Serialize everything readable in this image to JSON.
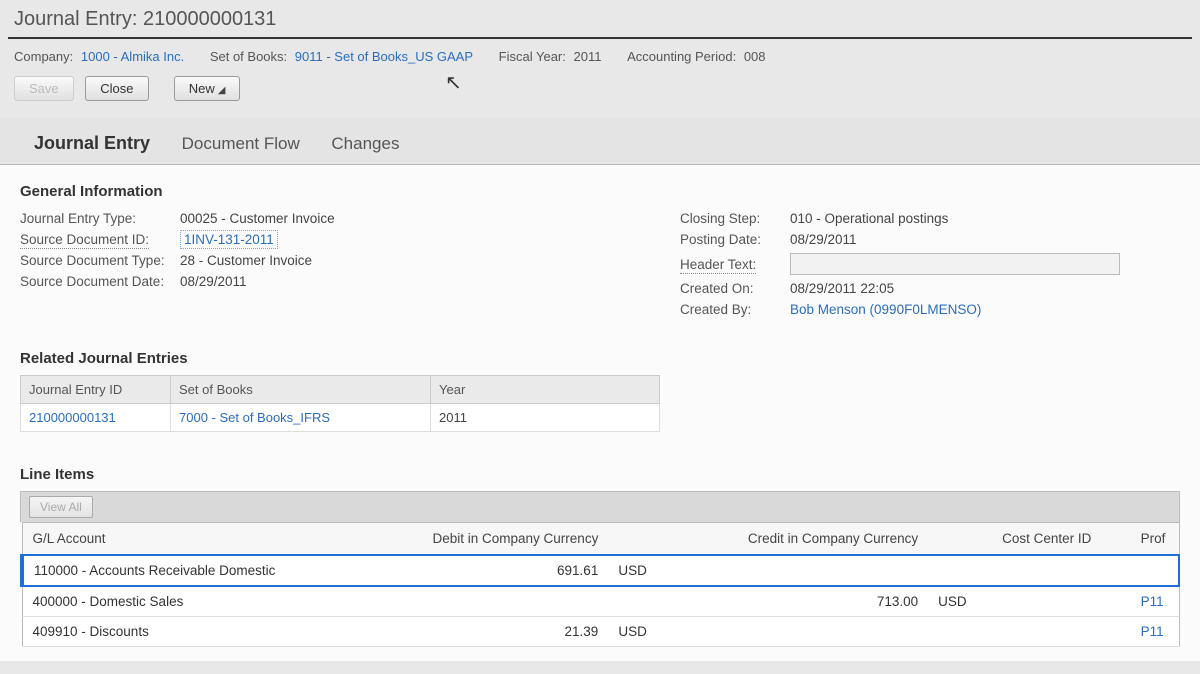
{
  "header": {
    "title_prefix": "Journal Entry:",
    "title_id": "210000000131"
  },
  "info_bar": {
    "company_label": "Company:",
    "company_value": "1000 - Almika Inc.",
    "sob_label": "Set of Books:",
    "sob_value": "9011 - Set of Books_US GAAP",
    "fy_label": "Fiscal Year:",
    "fy_value": "2011",
    "ap_label": "Accounting Period:",
    "ap_value": "008"
  },
  "buttons": {
    "save": "Save",
    "close": "Close",
    "new": "New"
  },
  "tabs": {
    "t1": "Journal Entry",
    "t2": "Document Flow",
    "t3": "Changes"
  },
  "general": {
    "title": "General Information",
    "left": {
      "je_type_k": "Journal Entry Type:",
      "je_type_v": "00025 - Customer Invoice",
      "src_id_k": "Source Document ID:",
      "src_id_v": "1INV-131-2011",
      "src_type_k": "Source Document Type:",
      "src_type_v": "28 - Customer Invoice",
      "src_date_k": "Source Document Date:",
      "src_date_v": "08/29/2011"
    },
    "right": {
      "closing_k": "Closing Step:",
      "closing_v": "010 - Operational postings",
      "posting_k": "Posting Date:",
      "posting_v": "08/29/2011",
      "header_text_k": "Header Text:",
      "header_text_v": "",
      "created_on_k": "Created On:",
      "created_on_v": "08/29/2011 22:05",
      "created_by_k": "Created By:",
      "created_by_v": "Bob Menson (0990F0LMENSO)"
    }
  },
  "related": {
    "title": "Related Journal Entries",
    "cols": {
      "c1": "Journal Entry ID",
      "c2": "Set of Books",
      "c3": "Year"
    },
    "row": {
      "id": "210000000131",
      "sob": "7000 - Set of Books_IFRS",
      "year": "2011"
    }
  },
  "line_items": {
    "title": "Line Items",
    "view_all": "View All",
    "cols": {
      "gl": "G/L Account",
      "debit": "Debit in Company Currency",
      "credit": "Credit in Company Currency",
      "cost_center": "Cost Center ID",
      "profit": "Prof"
    },
    "rows": [
      {
        "gl": "110000 - Accounts Receivable Domestic",
        "debit_amt": "691.61",
        "debit_cur": "USD",
        "credit_amt": "",
        "credit_cur": "",
        "profit": ""
      },
      {
        "gl": "400000 - Domestic Sales",
        "debit_amt": "",
        "debit_cur": "",
        "credit_amt": "713.00",
        "credit_cur": "USD",
        "profit": "P11"
      },
      {
        "gl": "409910 - Discounts",
        "debit_amt": "21.39",
        "debit_cur": "USD",
        "credit_amt": "",
        "credit_cur": "",
        "profit": "P11"
      }
    ]
  }
}
